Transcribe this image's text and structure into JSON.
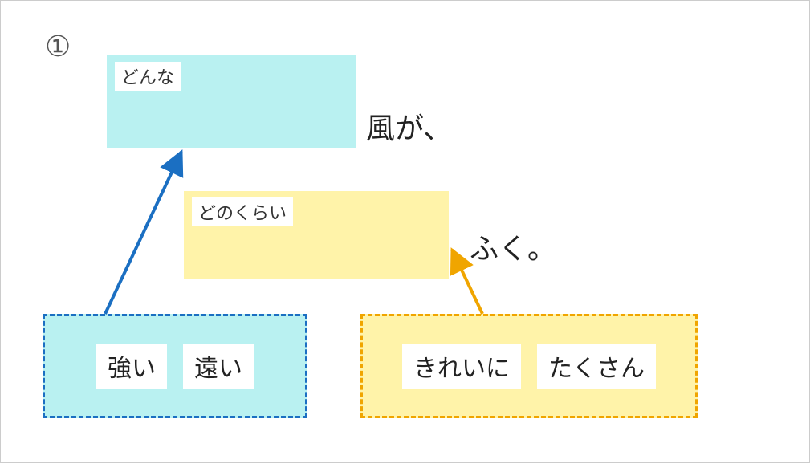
{
  "number_label": "①",
  "slots": {
    "cyan": {
      "label": "どんな"
    },
    "yellow": {
      "label": "どのくらい"
    }
  },
  "sentence": {
    "part1": "風が、",
    "part2": "ふく。"
  },
  "banks": {
    "cyan": {
      "items": [
        "強い",
        "遠い"
      ]
    },
    "yellow": {
      "items": [
        "きれいに",
        "たくさん"
      ]
    }
  },
  "colors": {
    "cyan_fill": "#b9f1f1",
    "cyan_stroke": "#1b6fc2",
    "yellow_fill": "#fff3a9",
    "yellow_stroke": "#f0a500"
  }
}
